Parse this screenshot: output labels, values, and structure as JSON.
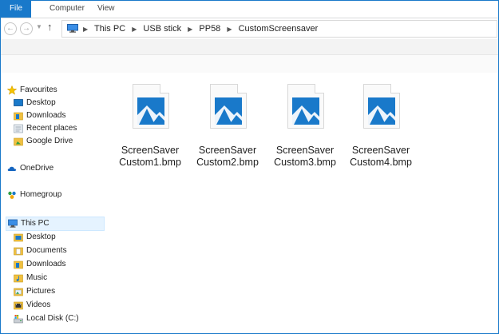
{
  "ribbon": {
    "tabs": [
      "File",
      "Computer",
      "View"
    ]
  },
  "address_bar": {
    "breadcrumbs": [
      "This PC",
      "USB stick",
      "PP58",
      "CustomScreensaver"
    ]
  },
  "nav_pane": {
    "favourites": {
      "label": "Favourites",
      "items": [
        "Desktop",
        "Downloads",
        "Recent places",
        "Google Drive"
      ]
    },
    "onedrive": "OneDrive",
    "homegroup": "Homegroup",
    "this_pc": {
      "label": "This PC",
      "items": [
        "Desktop",
        "Documents",
        "Downloads",
        "Music",
        "Pictures",
        "Videos",
        "Local Disk (C:)"
      ]
    }
  },
  "files": [
    {
      "line1": "ScreenSaver",
      "line2": "Custom1.bmp"
    },
    {
      "line1": "ScreenSaver",
      "line2": "Custom2.bmp"
    },
    {
      "line1": "ScreenSaver",
      "line2": "Custom3.bmp"
    },
    {
      "line1": "ScreenSaver",
      "line2": "Custom4.bmp"
    }
  ],
  "colors": {
    "accent": "#1979ca",
    "thumbnail": "#1979ca",
    "selection": "#e5f3ff"
  }
}
